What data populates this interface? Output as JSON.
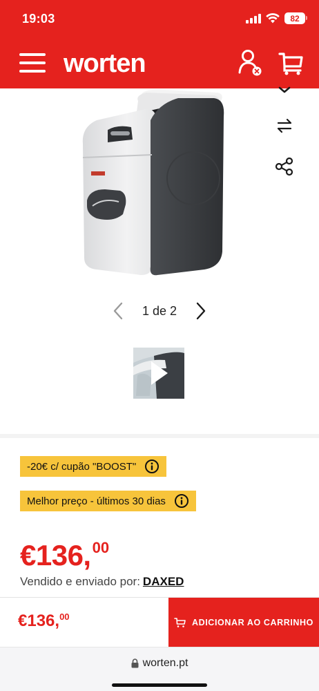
{
  "status_bar": {
    "time": "19:03",
    "battery": "82"
  },
  "header": {
    "logo_text": "worten"
  },
  "gallery": {
    "pager_text": "1 de 2",
    "side_actions": [
      "favorite-icon",
      "compare-icon",
      "share-icon"
    ]
  },
  "promotions": {
    "coupon_label": "-20€ c/ cupão \"BOOST\"",
    "best_price_label": "Melhor preço - últimos 30 dias"
  },
  "price": {
    "euros": "€136,",
    "cents": "00"
  },
  "seller": {
    "prefix": "Vendido e enviado por:",
    "name": "DAXED"
  },
  "sticky_bar": {
    "price_euros": "€136,",
    "price_cents": "00",
    "add_to_cart_label": "ADICIONAR AO CARRINHO"
  },
  "browser": {
    "url": "worten.pt"
  },
  "colors": {
    "brand_red": "#e5221e",
    "badge_yellow": "#f7c43b"
  }
}
